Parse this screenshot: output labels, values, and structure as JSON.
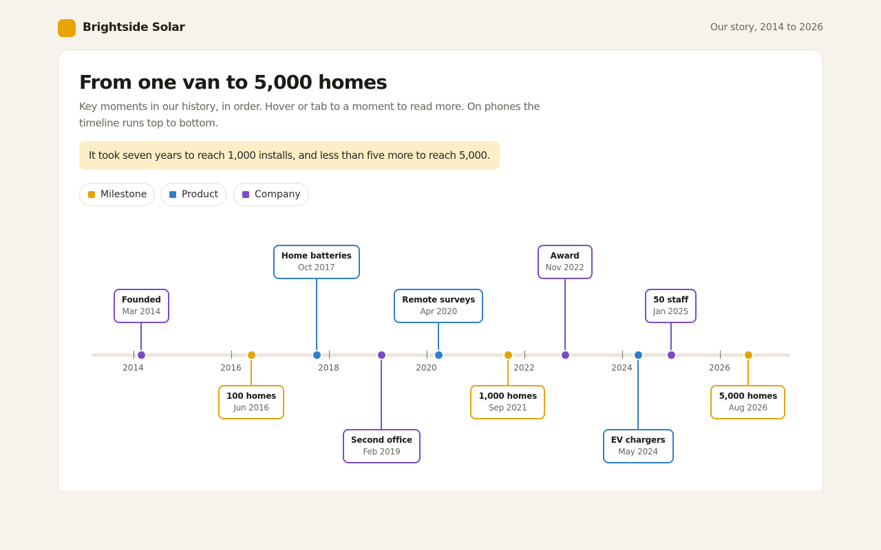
{
  "brand": {
    "name": "Brightside Solar",
    "tagline": "Our story, 2014 to 2026"
  },
  "colors": {
    "milestone": "#e8a406",
    "product": "#2f7ecb",
    "company": "#7a4cc4",
    "brand": "#e8a406",
    "callout_bg": "#fcefc7"
  },
  "hero": {
    "title": "From one van to 5,000 homes",
    "subtitle": "Key moments in our history, in order. Hover or tab to a moment to read more. On phones the timeline runs top to bottom.",
    "callout": "It took seven years to reach 1,000 installs, and less than five more to reach 5,000."
  },
  "legend": [
    {
      "label": "Milestone",
      "category": "milestone"
    },
    {
      "label": "Product",
      "category": "product"
    },
    {
      "label": "Company",
      "category": "company"
    }
  ],
  "timeline": {
    "axis_years": [
      "2014",
      "2016",
      "2018",
      "2020",
      "2022",
      "2024",
      "2026"
    ],
    "events": [
      {
        "title": "Founded",
        "date": "Mar 2014",
        "category": "company"
      },
      {
        "title": "100 homes",
        "date": "Jun 2016",
        "category": "milestone"
      },
      {
        "title": "Home batteries",
        "date": "Oct 2017",
        "category": "product"
      },
      {
        "title": "Second office",
        "date": "Feb 2019",
        "category": "company"
      },
      {
        "title": "Remote surveys",
        "date": "Apr 2020",
        "category": "product"
      },
      {
        "title": "1,000 homes",
        "date": "Sep 2021",
        "category": "milestone"
      },
      {
        "title": "Award",
        "date": "Nov 2022",
        "category": "company"
      },
      {
        "title": "EV chargers",
        "date": "May 2024",
        "category": "product"
      },
      {
        "title": "50 staff",
        "date": "Jan 2025",
        "category": "company"
      },
      {
        "title": "5,000 homes",
        "date": "Aug 2026",
        "category": "milestone"
      }
    ]
  }
}
